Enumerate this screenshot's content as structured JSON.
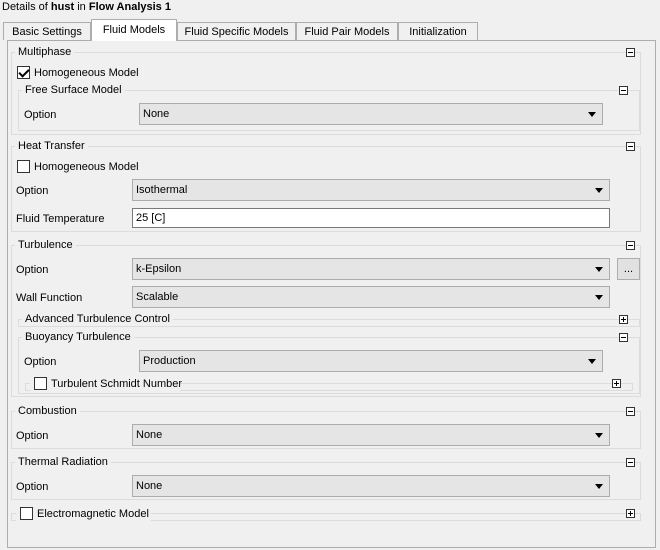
{
  "header": {
    "prefix": "Details of ",
    "object": "hust",
    "middle": " in ",
    "analysis": "Flow Analysis 1"
  },
  "tabs": [
    {
      "label": "Basic Settings",
      "active": false
    },
    {
      "label": "Fluid Models",
      "active": true
    },
    {
      "label": "Fluid Specific Models",
      "active": false
    },
    {
      "label": "Fluid Pair Models",
      "active": false
    },
    {
      "label": "Initialization",
      "active": false
    }
  ],
  "multiphase": {
    "title": "Multiphase",
    "homogeneous_label": "Homogeneous Model",
    "homogeneous_checked": true,
    "free_surface": {
      "title": "Free Surface Model",
      "option_label": "Option",
      "option_value": "None"
    }
  },
  "heat_transfer": {
    "title": "Heat Transfer",
    "homogeneous_label": "Homogeneous Model",
    "homogeneous_checked": false,
    "option_label": "Option",
    "option_value": "Isothermal",
    "temp_label": "Fluid Temperature",
    "temp_value": "25 [C]"
  },
  "turbulence": {
    "title": "Turbulence",
    "option_label": "Option",
    "option_value": "k-Epsilon",
    "more_button": "...",
    "wall_label": "Wall Function",
    "wall_value": "Scalable",
    "advanced_title": "Advanced Turbulence Control",
    "buoyancy": {
      "title": "Buoyancy Turbulence",
      "option_label": "Option",
      "option_value": "Production",
      "schmidt_label": "Turbulent Schmidt Number",
      "schmidt_checked": false
    }
  },
  "combustion": {
    "title": "Combustion",
    "option_label": "Option",
    "option_value": "None"
  },
  "thermal_radiation": {
    "title": "Thermal Radiation",
    "option_label": "Option",
    "option_value": "None"
  },
  "electromagnetic": {
    "label": "Electromagnetic Model",
    "checked": false
  }
}
